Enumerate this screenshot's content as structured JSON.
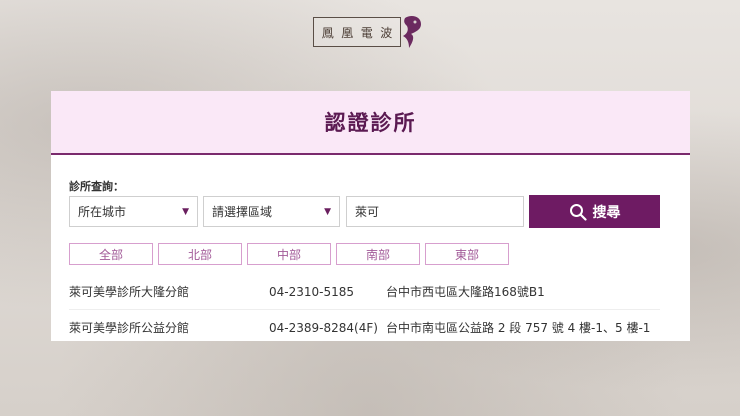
{
  "logo": {
    "chars": [
      "鳳",
      "凰",
      "電",
      "波"
    ]
  },
  "page_title": "認證診所",
  "filter": {
    "label": "診所查詢：",
    "city_select": "所在城市",
    "area_select": "請選擇區域",
    "keyword_value": "萊可",
    "search_button": "搜尋"
  },
  "regions": [
    "全部",
    "北部",
    "中部",
    "南部",
    "東部"
  ],
  "clinics": [
    {
      "name": "萊可美學診所大隆分館",
      "phone": "04-2310-5185",
      "address": "台中市西屯區大隆路168號B1"
    },
    {
      "name": "萊可美學診所公益分館",
      "phone": "04-2389-8284(4F)",
      "address": "台中市南屯區公益路 2 段 757 號 4 樓-1、5 樓-1"
    }
  ],
  "colors": {
    "accent": "#6e1b63",
    "header_bg": "#fae8f7",
    "region_border": "#d79fce"
  }
}
